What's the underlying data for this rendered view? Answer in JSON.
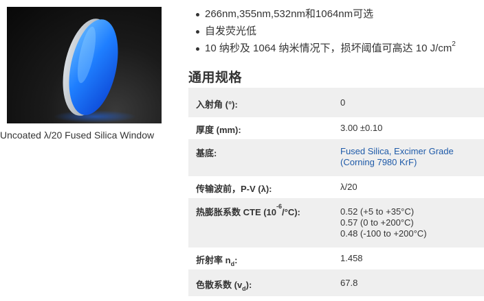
{
  "product": {
    "image_alt": "uncoated fused silica window disc",
    "caption": "Uncoated λ/20 Fused Silica Window"
  },
  "features": [
    {
      "text": "266nm,355nm,532nm和1064nm可选"
    },
    {
      "text": "自发荧光低"
    },
    {
      "text": "10 纳秒及 1064 纳米情况下，损坏阈值可高达 10 J/cm",
      "sup": "2"
    }
  ],
  "specs": {
    "title": "通用规格",
    "rows": [
      {
        "label": "入射角 (°):",
        "value": "0"
      },
      {
        "label": "厚度 (mm):",
        "value": "3.00 ±0.10"
      },
      {
        "label": "基底:",
        "value_lines": [
          "Fused Silica, Excimer Grade",
          "(Corning 7980 KrF)"
        ]
      },
      {
        "label": "传输波前，P-V (λ):",
        "value": "λ/20"
      },
      {
        "label_pre": "热膨胀系数 CTE (10",
        "label_sup": "-6",
        "label_post": "/°C):",
        "value_lines": [
          "0.52 (+5 to +35°C)",
          "0.57 (0 to +200°C)",
          "0.48 (-100 to +200°C)"
        ]
      },
      {
        "label_pre": "折射率 n",
        "label_sub": "d",
        "label_post": ":",
        "value": "1.458"
      },
      {
        "label_pre": "色散系数 (v",
        "label_sub": "d",
        "label_post": "):",
        "value": "67.8"
      }
    ]
  },
  "colors": {
    "link": "#1e5aa8",
    "row_shade": "#efefef",
    "text": "#333333"
  }
}
